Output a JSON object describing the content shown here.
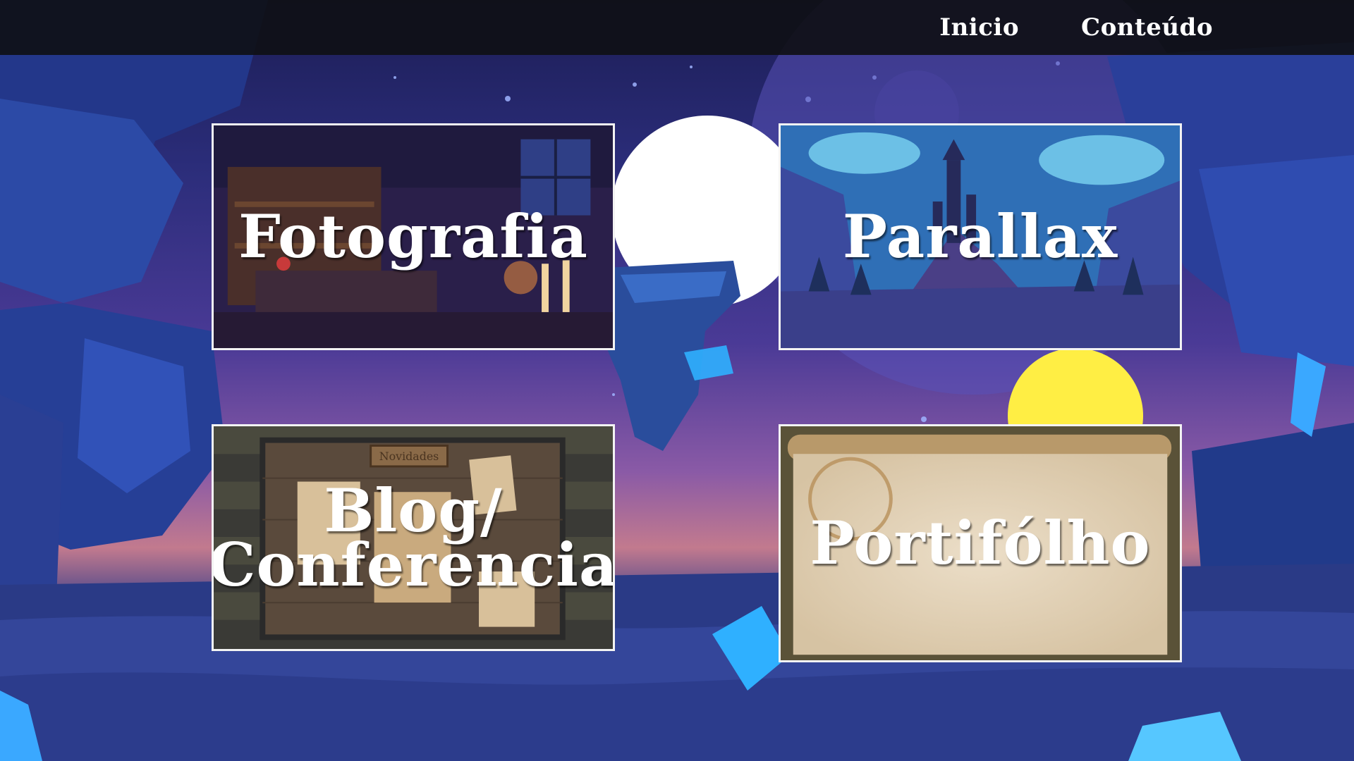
{
  "nav": {
    "links": [
      {
        "label": "Inicio"
      },
      {
        "label": "Conteúdo"
      }
    ]
  },
  "cards": [
    {
      "title": "Fotografia",
      "art": "tavern-interior"
    },
    {
      "title": "Parallax",
      "art": "castle-mountains"
    },
    {
      "title_line1": "Blog/",
      "title_line2": "Conferencia",
      "art": "wooden-notice-board",
      "board_sign": "Novidades"
    },
    {
      "title": "Portifólho",
      "art": "parchment-scroll"
    }
  ],
  "colors": {
    "topbar": "#0f1016",
    "card_border": "#f3f3f3",
    "moon": "#ffffff",
    "sun": "#ffee44",
    "crystal": "#3aa8ff"
  }
}
